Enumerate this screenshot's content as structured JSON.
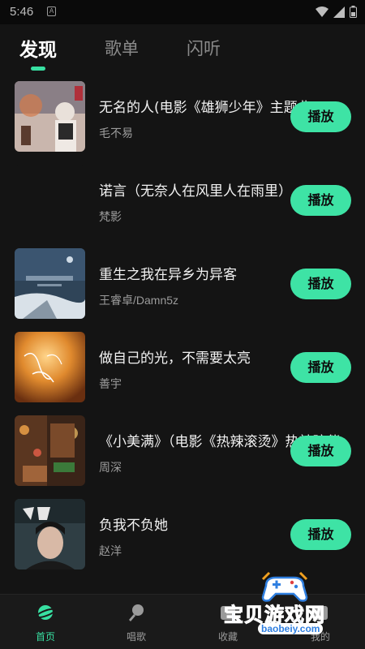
{
  "status_bar": {
    "time": "5:46",
    "notification_glyph": "A"
  },
  "tabs": [
    {
      "label": "发现",
      "active": true
    },
    {
      "label": "歌单",
      "active": false
    },
    {
      "label": "闪听",
      "active": false
    }
  ],
  "accent_color": "#3ee3a5",
  "songs": [
    {
      "title": "无名的人(电影《雄狮少年》主题曲)",
      "artist": "毛不易",
      "button": "播放",
      "cover": "movie-poster"
    },
    {
      "title": "诺言（无奈人在风里人在雨里）",
      "artist": "梵影",
      "button": "播放",
      "cover": "blank"
    },
    {
      "title": "重生之我在异乡为异客",
      "artist": "王睿卓/Damn5z",
      "button": "播放",
      "cover": "snow-landscape"
    },
    {
      "title": "做自己的光，不需要太亮",
      "artist": "善宇",
      "button": "播放",
      "cover": "orange-glow"
    },
    {
      "title": "《小美满》（电影《热辣滚烫》热辣陪伴",
      "artist": "周深",
      "button": "播放",
      "cover": "night-street"
    },
    {
      "title": "负我不负她",
      "artist": "赵洋",
      "button": "播放",
      "cover": "portrait"
    }
  ],
  "bottom_nav": [
    {
      "label": "首页",
      "icon": "planet-icon",
      "active": true
    },
    {
      "label": "唱歌",
      "icon": "microphone-icon",
      "active": false
    },
    {
      "label": "收藏",
      "icon": "favorite-icon",
      "active": false
    },
    {
      "label": "我的",
      "icon": "profile-icon",
      "active": false
    }
  ],
  "watermark": {
    "text": "宝贝游戏网",
    "url": "baobeiy.com"
  }
}
